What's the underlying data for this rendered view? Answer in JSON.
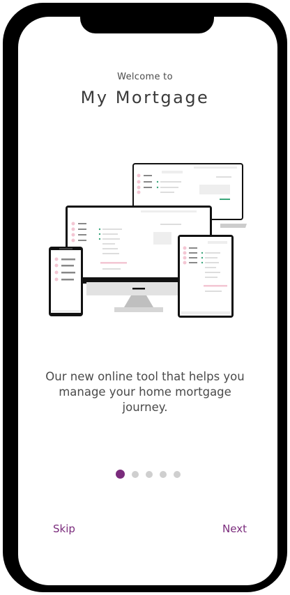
{
  "welcome": {
    "subtitle": "Welcome to",
    "title": "My Mortgage"
  },
  "illustration": {
    "icon": "devices-illustration"
  },
  "description": "Our new online tool that helps you manage your home mortgage journey.",
  "pagination": {
    "total": 5,
    "current": 1
  },
  "actions": {
    "skip_label": "Skip",
    "next_label": "Next"
  },
  "colors": {
    "accent": "#7a2b7c",
    "dot_inactive": "#cfcfcf",
    "text": "#4a4a4a",
    "frame": "#000000"
  }
}
